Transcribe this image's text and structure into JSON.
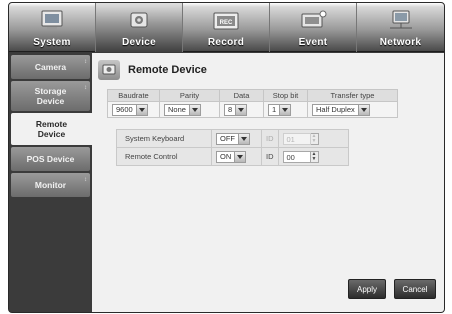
{
  "tabs": [
    {
      "label": "System",
      "icon": "system-monitor-icon",
      "active": false
    },
    {
      "label": "Device",
      "icon": "device-camera-icon",
      "active": true
    },
    {
      "label": "Record",
      "icon": "record-rec-icon",
      "active": false
    },
    {
      "label": "Event",
      "icon": "event-alarm-icon",
      "active": false
    },
    {
      "label": "Network",
      "icon": "network-computer-icon",
      "active": false
    }
  ],
  "sidebar": {
    "items": [
      {
        "label": "Camera",
        "active": false
      },
      {
        "label": "Storage Device",
        "active": false
      },
      {
        "label": "Remote Device",
        "active": true
      },
      {
        "label": "POS Device",
        "active": false
      },
      {
        "label": "Monitor",
        "active": false
      }
    ]
  },
  "panel": {
    "title": "Remote Device",
    "title_icon": "remote-device-icon"
  },
  "serial": {
    "headers": [
      "Baudrate",
      "Parity",
      "Data",
      "Stop bit",
      "Transfer type"
    ],
    "values": [
      "9600",
      "None",
      "8",
      "1",
      "Half Duplex"
    ]
  },
  "options": [
    {
      "label": "System Keyboard",
      "value": "OFF",
      "id_label": "ID",
      "id_value": "01",
      "id_enabled": false
    },
    {
      "label": "Remote Control",
      "value": "ON",
      "id_label": "ID",
      "id_value": "00",
      "id_enabled": true
    }
  ],
  "buttons": {
    "apply": "Apply",
    "cancel": "Cancel"
  }
}
